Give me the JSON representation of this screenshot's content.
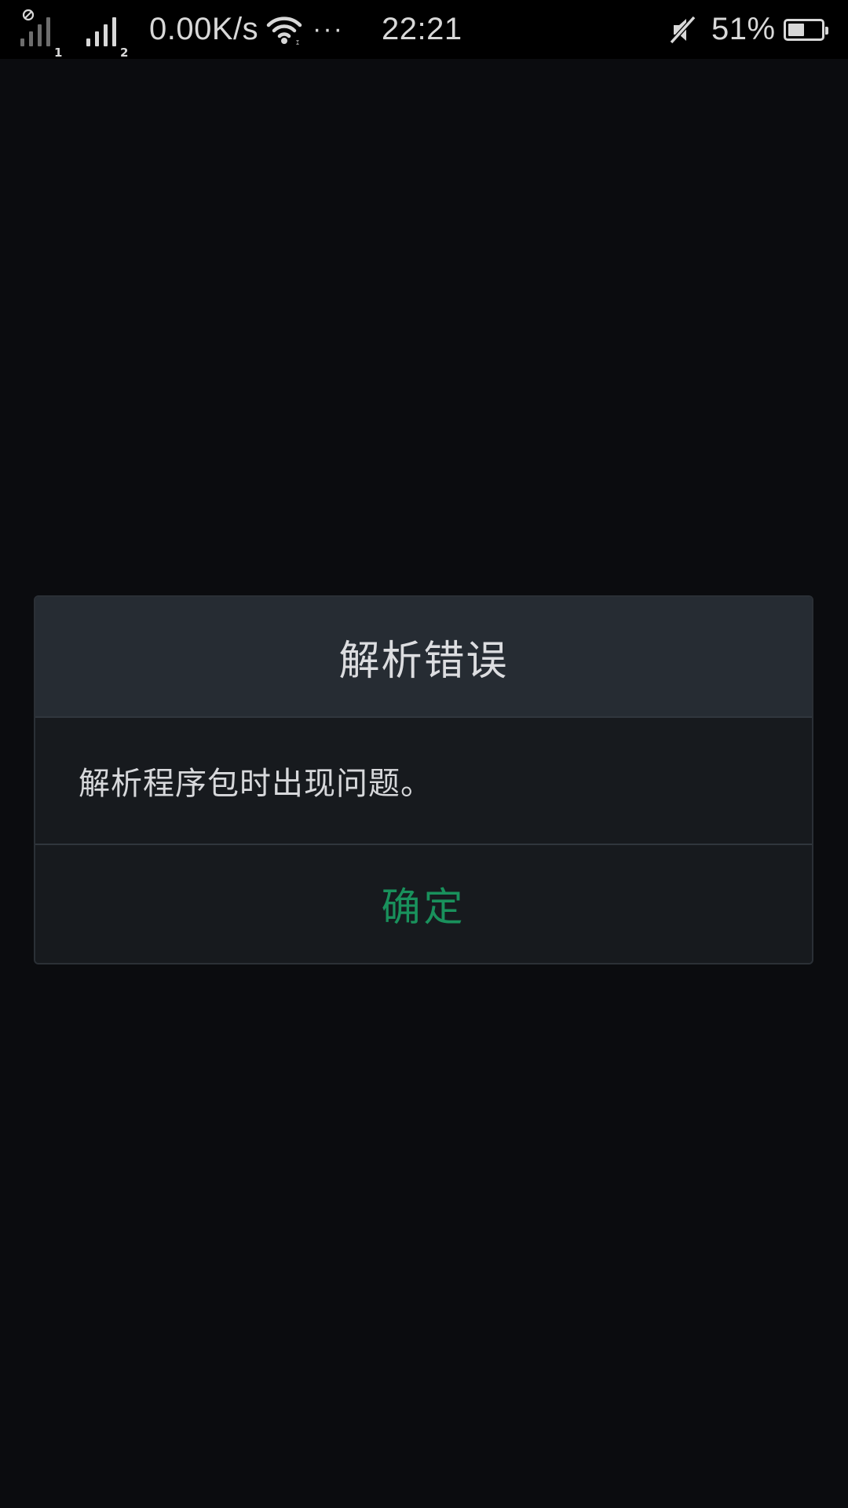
{
  "status_bar": {
    "sim1_label": "1",
    "sim2_label": "2",
    "net_speed": "0.00K/s",
    "more_indicator": "···",
    "time": "22:21",
    "battery_percent": "51%",
    "battery_level": 0.51,
    "icons": [
      "no-sim-signal-icon",
      "signal-icon",
      "wifi-icon",
      "mute-icon",
      "battery-icon"
    ]
  },
  "dialog": {
    "title": "解析错误",
    "message": "解析程序包时出现问题。",
    "ok_label": "确定"
  },
  "colors": {
    "background": "#0b0c0f",
    "dialog_header": "#262c33",
    "dialog_body": "#171a1e",
    "accent": "#19915c",
    "text": "#dcdde0"
  }
}
